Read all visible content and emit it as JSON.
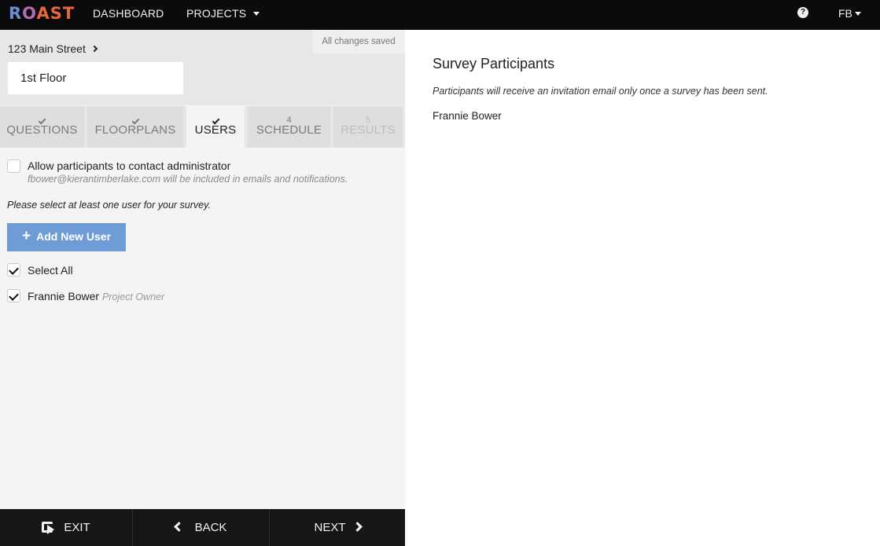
{
  "nav": {
    "logo": "ROAST",
    "dashboard": "DASHBOARD",
    "projects": "PROJECTS",
    "help_icon": "question-circle-icon",
    "user": "FB"
  },
  "left": {
    "save_status": "All changes saved",
    "breadcrumb": "123 Main Street",
    "floor_value": "1st Floor",
    "tabs": [
      {
        "mark": "check",
        "label": "QUESTIONS",
        "state": "done"
      },
      {
        "mark": "check",
        "label": "FLOORPLANS",
        "state": "done"
      },
      {
        "mark": "check",
        "label": "USERS",
        "state": "active"
      },
      {
        "mark": "4",
        "label": "SCHEDULE",
        "state": "pending"
      },
      {
        "mark": "5",
        "label": "RESULTS",
        "state": "disabled"
      }
    ],
    "allow_contact": {
      "label": "Allow participants to contact administrator",
      "note": "fbower@kierantimberlake.com will be included in emails and notifications.",
      "checked": false
    },
    "instruction": "Please select at least one user for your survey.",
    "add_user_label": "Add New User",
    "select_all": {
      "label": "Select All",
      "checked": true
    },
    "users": [
      {
        "name": "Frannie Bower",
        "role": "Project Owner",
        "checked": true
      }
    ]
  },
  "footer": {
    "exit": "EXIT",
    "back": "BACK",
    "next": "NEXT"
  },
  "right": {
    "title": "Survey Participants",
    "note": "Participants will receive an invitation email only once a survey has been sent.",
    "participants": [
      "Frannie Bower"
    ]
  },
  "colors": {
    "topbar": "#0b0b0b",
    "accent_button": "#6f9bd6",
    "footer": "#161616",
    "logo_orange": "#e8663a",
    "logo_blue": "#6a8fd0"
  }
}
